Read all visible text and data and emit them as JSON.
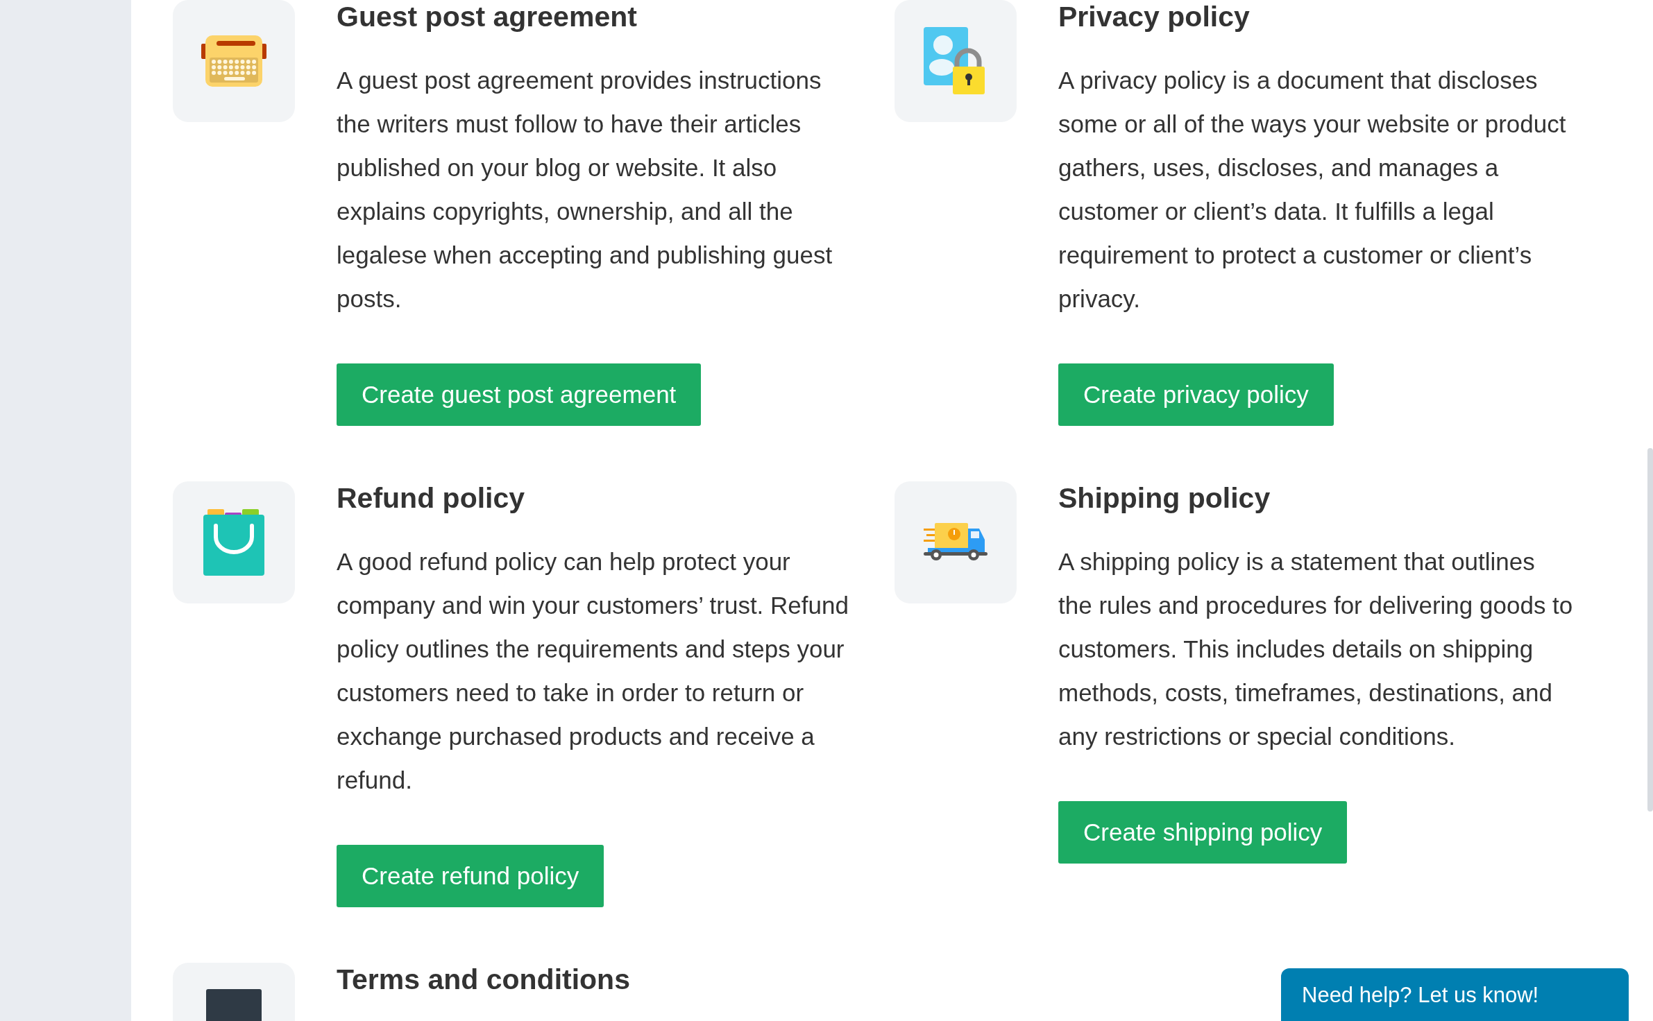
{
  "cards": [
    {
      "title": "Guest post agreement",
      "description": "A guest post agreement provides instructions the writers must follow to have their articles published on your blog or website. It also explains copyrights, ownership, and all the legalese when accepting and publishing guest posts.",
      "button": "Create guest post agreement"
    },
    {
      "title": "Privacy policy",
      "description": "A privacy policy is a document that discloses some or all of the ways your website or product gathers, uses, discloses, and manages a customer or client’s data. It fulfills a legal requirement to protect a customer or client’s privacy.",
      "button": "Create privacy policy"
    },
    {
      "title": "Refund policy",
      "description": "A good refund policy can help protect your company and win your customers’ trust. Refund policy outlines the requirements and steps your customers need to take in order to return or exchange purchased products and receive a refund.",
      "button": "Create refund policy"
    },
    {
      "title": "Shipping policy",
      "description": "A shipping policy is a statement that outlines the rules and procedures for delivering goods to customers. This includes details on shipping methods, costs, timeframes, destinations, and any restrictions or special conditions.",
      "button": "Create shipping policy"
    },
    {
      "title": "Terms and conditions"
    }
  ],
  "help_button": "Need help? Let us know!"
}
